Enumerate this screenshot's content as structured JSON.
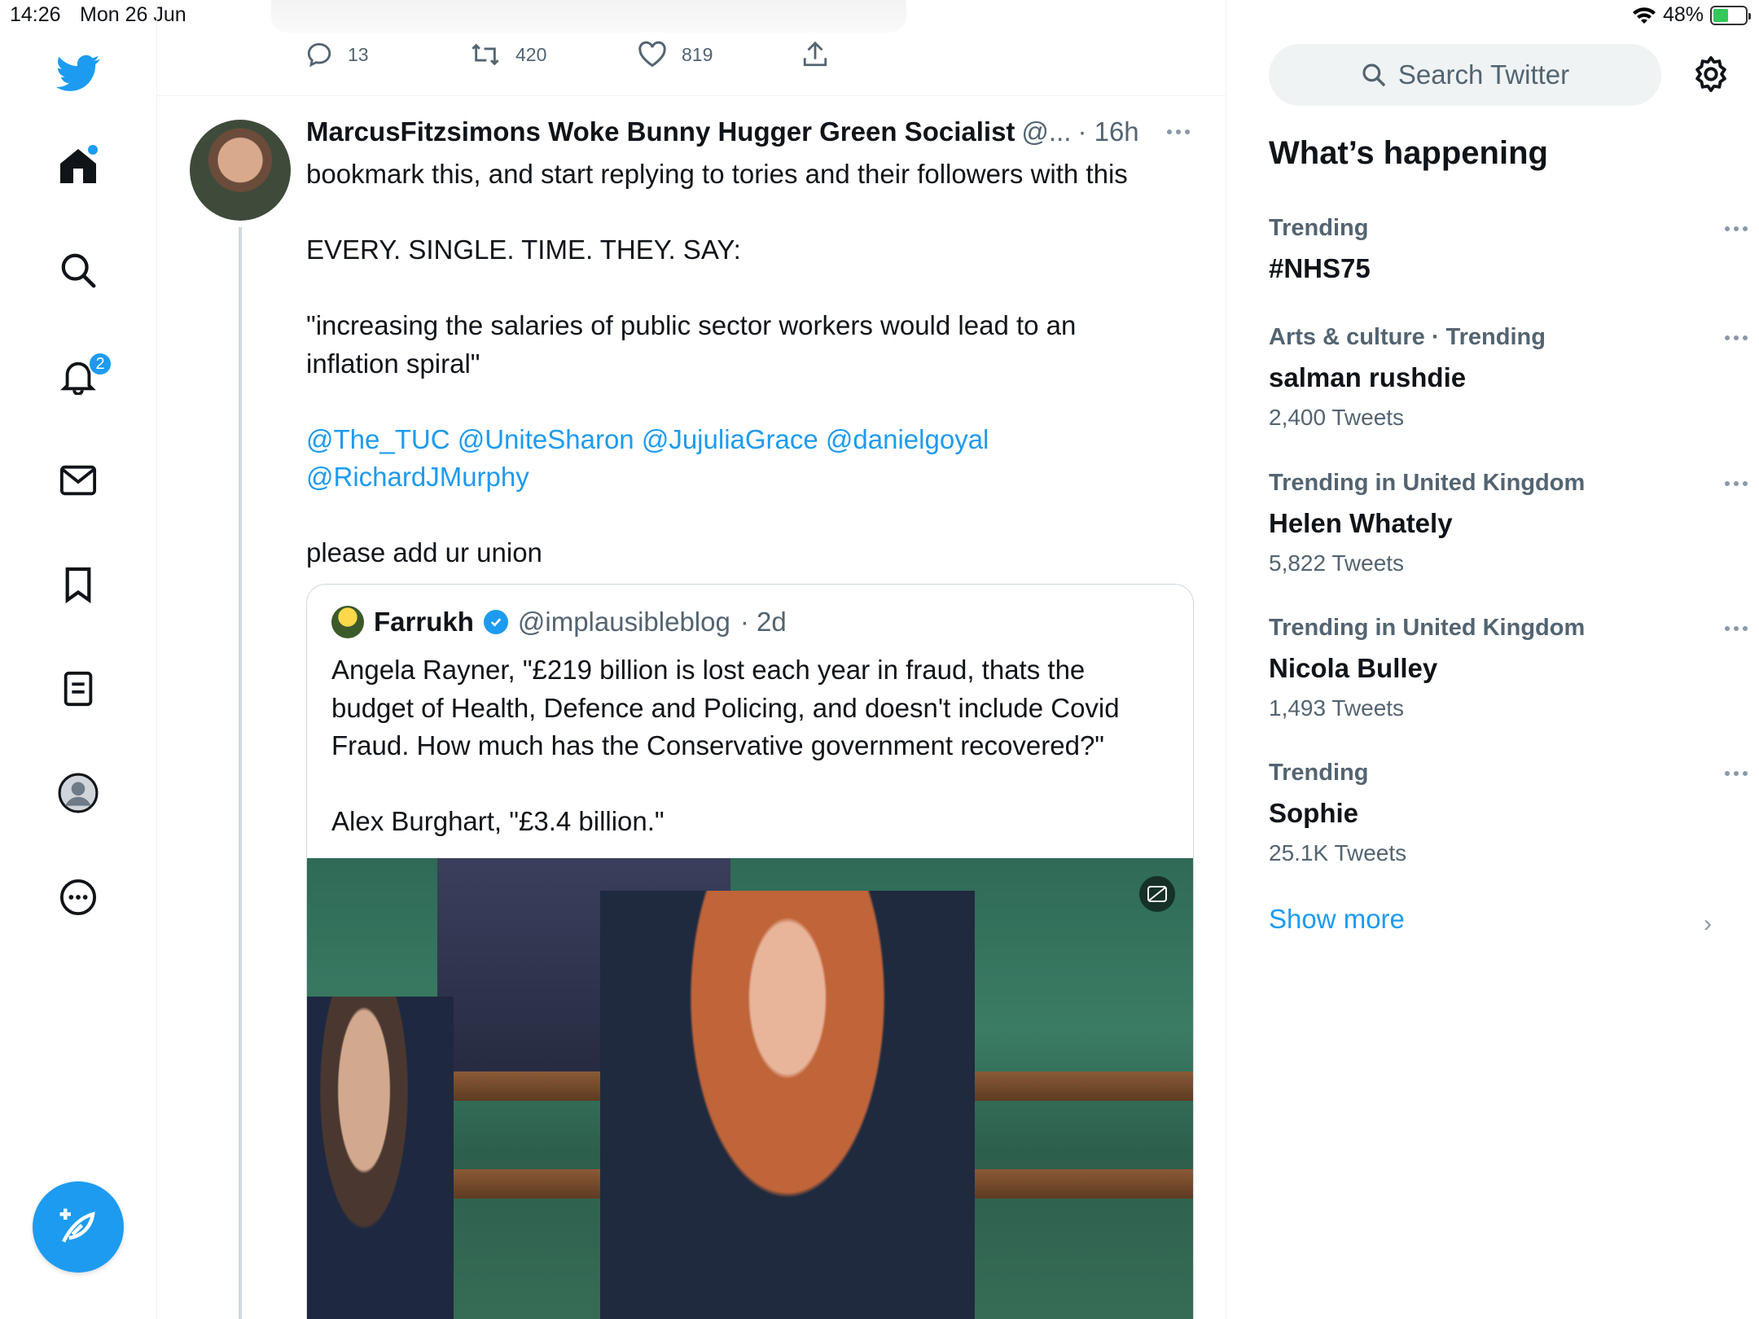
{
  "status_bar": {
    "time": "14:26",
    "date": "Mon 26 Jun",
    "battery": "48%",
    "battery_level": 0.48
  },
  "nav": {
    "notification_badge": "2",
    "icons": [
      "twitter-bird-icon",
      "home-icon",
      "search-icon",
      "bell-icon",
      "mail-icon",
      "bookmark-icon",
      "lists-icon",
      "profile-icon",
      "more-icon"
    ]
  },
  "previous_tweet": {
    "replies": "13",
    "retweets": "420",
    "likes": "819"
  },
  "tweet": {
    "name": "MarcusFitzsimons Woke Bunny Hugger Green Socialist",
    "handle": "@...",
    "time": "· 16h",
    "lines": {
      "l1": "bookmark this, and start replying to tories and their followers with this",
      "l2": "EVERY. SINGLE. TIME. THEY. SAY:",
      "l3": "\"increasing the salaries of public sector workers would lead to an",
      "l4": "inflation spiral\"",
      "l5": "@The_TUC @UniteSharon @JujuliaGrace @danielgoyal",
      "l6": "@RichardJMurphy",
      "l7": "please add ur union"
    },
    "quote": {
      "name": "Farrukh",
      "handle": "@implausibleblog",
      "time": "· 2d",
      "l1": "Angela Rayner, \"£219 billion is lost each year in fraud, thats the",
      "l2": "budget of Health, Defence and Policing, and doesn't include Covid",
      "l3": "Fraud. How much has the Conservative government recovered?\"",
      "l4": "Alex Burghart, \"£3.4 billion.\""
    }
  },
  "sidebar": {
    "search_placeholder": "Search Twitter",
    "title": "What’s happening",
    "trends": [
      {
        "meta": "Trending",
        "name": "#NHS75",
        "count": ""
      },
      {
        "meta": "Arts & culture · Trending",
        "name": "salman rushdie",
        "count": "2,400 Tweets"
      },
      {
        "meta": "Trending in United Kingdom",
        "name": "Helen Whately",
        "count": "5,822 Tweets"
      },
      {
        "meta": "Trending in United Kingdom",
        "name": "Nicola Bulley",
        "count": "1,493 Tweets"
      },
      {
        "meta": "Trending",
        "name": "Sophie",
        "count": "25.1K Tweets"
      }
    ],
    "show_more": "Show more"
  },
  "colors": {
    "accent": "#1d9bf0",
    "text": "#0f1419",
    "muted": "#536471"
  }
}
